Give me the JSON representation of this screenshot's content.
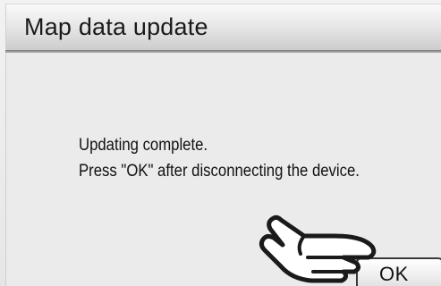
{
  "dialog": {
    "title": "Map data update",
    "message_line1": "Updating complete.",
    "message_line2": "Press \"OK\" after disconnecting the device."
  },
  "buttons": {
    "ok_label": "OK"
  },
  "icons": {
    "pointer": "pointing-hand-icon"
  }
}
